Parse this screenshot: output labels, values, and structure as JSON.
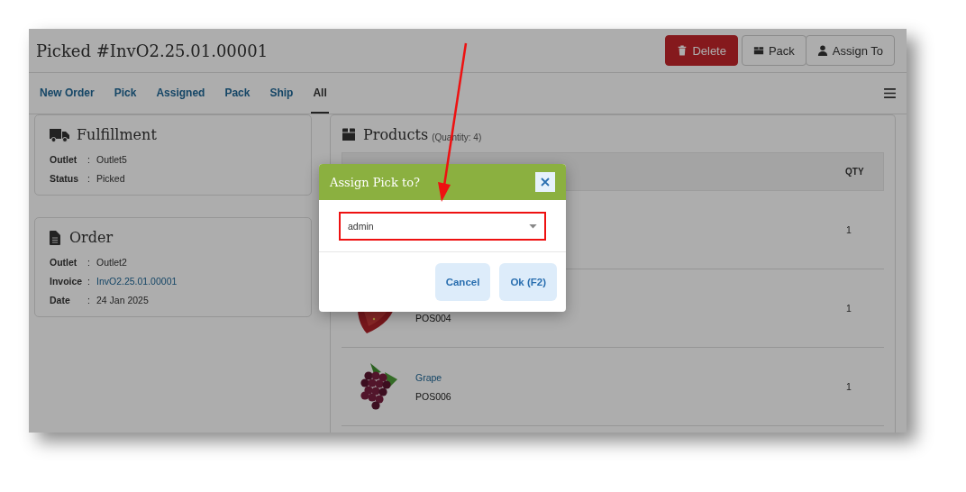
{
  "header": {
    "title": "Picked #InvO2.25.01.00001",
    "actions": [
      {
        "label": "Delete",
        "kind": "delete"
      },
      {
        "label": "Pack",
        "kind": "pack"
      },
      {
        "label": "Assign To",
        "kind": "assign"
      }
    ]
  },
  "tabs": [
    {
      "label": "New Order",
      "selected": false
    },
    {
      "label": "Pick",
      "selected": false
    },
    {
      "label": "Assigned",
      "selected": false
    },
    {
      "label": "Pack",
      "selected": false
    },
    {
      "label": "Ship",
      "selected": false
    },
    {
      "label": "All",
      "selected": true
    }
  ],
  "cards": [
    {
      "title": "Fulfillment",
      "kind": "truck",
      "fields": [
        {
          "label": "Outlet",
          "separator": ":",
          "value": "Outlet5",
          "link": false
        },
        {
          "label": "Status",
          "separator": ":",
          "value": "Picked",
          "link": false
        }
      ]
    },
    {
      "title": "Order",
      "kind": "document",
      "fields": [
        {
          "label": "Outlet",
          "separator": ":",
          "value": "Outlet2",
          "link": false
        },
        {
          "label": "Invoice",
          "separator": ":",
          "value": "InvO2.25.01.00001",
          "link": true
        },
        {
          "label": "Date",
          "separator": ":",
          "value": "24 Jan 2025",
          "link": false
        }
      ]
    }
  ],
  "products": {
    "title": "Products",
    "note": "(Quantity: 4)",
    "columns": [
      {
        "label": "QTY"
      }
    ],
    "rows": [
      {
        "qty": "1"
      },
      {
        "code": "POS004",
        "qty": "1"
      },
      {
        "name": "Grape",
        "code": "POS006",
        "qty": "1"
      }
    ]
  },
  "modal": {
    "title": "Assign Pick to?",
    "select_value": "admin",
    "buttons": [
      "Cancel",
      "Ok (F2)"
    ]
  }
}
